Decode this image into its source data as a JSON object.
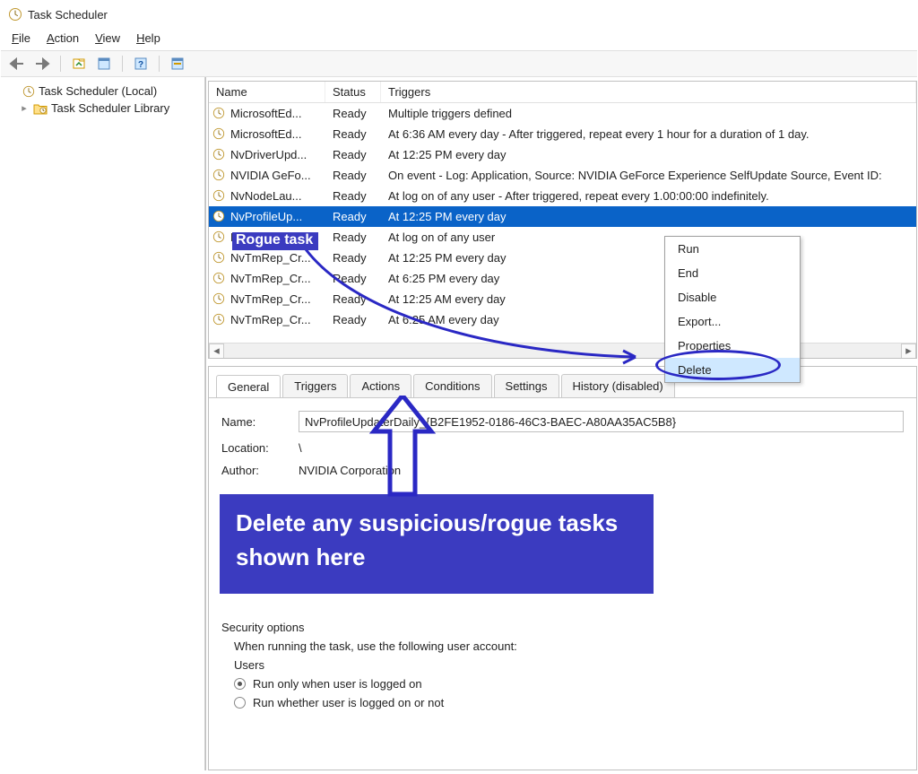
{
  "title": "Task Scheduler",
  "menu": {
    "file": "File",
    "action": "Action",
    "view": "View",
    "help": "Help"
  },
  "sidebar": {
    "root": "Task Scheduler (Local)",
    "library": "Task Scheduler Library"
  },
  "columns": {
    "name": "Name",
    "status": "Status",
    "triggers": "Triggers"
  },
  "tasks": [
    {
      "name": "MicrosoftEd...",
      "status": "Ready",
      "trigger": "Multiple triggers defined",
      "selected": false
    },
    {
      "name": "MicrosoftEd...",
      "status": "Ready",
      "trigger": "At 6:36 AM every day - After triggered, repeat every 1 hour for a duration of 1 day.",
      "selected": false
    },
    {
      "name": "NvDriverUpd...",
      "status": "Ready",
      "trigger": "At 12:25 PM every day",
      "selected": false
    },
    {
      "name": "NVIDIA GeFo...",
      "status": "Ready",
      "trigger": "On event - Log: Application, Source: NVIDIA GeForce Experience SelfUpdate Source, Event ID:",
      "selected": false
    },
    {
      "name": "NvNodeLau...",
      "status": "Ready",
      "trigger": "At log on of any user - After triggered, repeat every 1.00:00:00 indefinitely.",
      "selected": false
    },
    {
      "name": "NvProfileUp...",
      "status": "Ready",
      "trigger": "At 12:25 PM every day",
      "selected": true
    },
    {
      "name": "NvProfileUp...",
      "status": "Ready",
      "trigger": "At log on of any user",
      "selected": false
    },
    {
      "name": "NvTmRep_Cr...",
      "status": "Ready",
      "trigger": "At 12:25 PM every day",
      "selected": false
    },
    {
      "name": "NvTmRep_Cr...",
      "status": "Ready",
      "trigger": "At 6:25 PM every day",
      "selected": false
    },
    {
      "name": "NvTmRep_Cr...",
      "status": "Ready",
      "trigger": "At 12:25 AM every day",
      "selected": false
    },
    {
      "name": "NvTmRep_Cr...",
      "status": "Ready",
      "trigger": "At 6:25 AM every day",
      "selected": false
    }
  ],
  "context_menu": {
    "items": [
      "Run",
      "End",
      "Disable",
      "Export...",
      "Properties",
      "Delete"
    ],
    "highlighted": "Delete"
  },
  "tabs": [
    "General",
    "Triggers",
    "Actions",
    "Conditions",
    "Settings",
    "History (disabled)"
  ],
  "active_tab": "General",
  "details": {
    "name_label": "Name:",
    "name_value": "NvProfileUpdaterDaily_{B2FE1952-0186-46C3-BAEC-A80AA35AC5B8}",
    "location_label": "Location:",
    "location_value": "\\",
    "author_label": "Author:",
    "author_value": "NVIDIA Corporation"
  },
  "security": {
    "group_label": "Security options",
    "prompt": "When running the task, use the following user account:",
    "account": "Users",
    "opt1": "Run only when user is logged on",
    "opt2": "Run whether user is logged on or not"
  },
  "annotations": {
    "rogue_label": "Rogue task",
    "banner": "Delete any suspicious/rogue tasks shown here"
  }
}
